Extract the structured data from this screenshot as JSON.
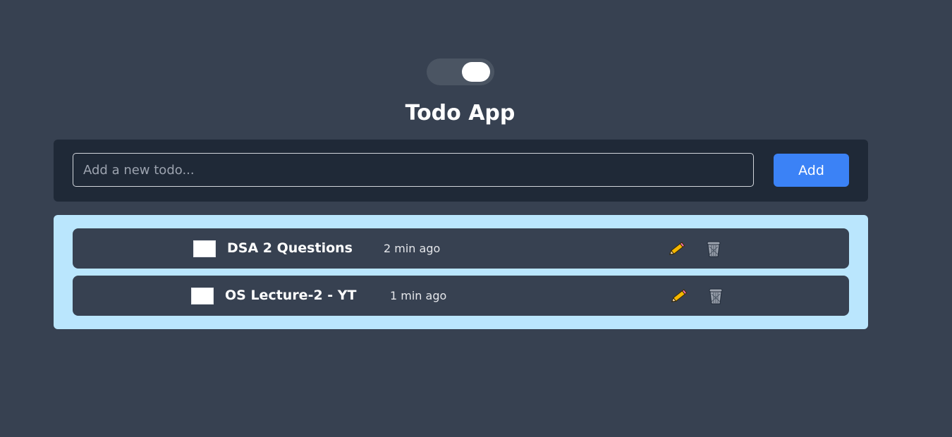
{
  "header": {
    "title": "Todo App"
  },
  "theme_toggle": {
    "state": "on"
  },
  "input": {
    "placeholder": "Add a new todo...",
    "value": ""
  },
  "add_button": {
    "label": "Add"
  },
  "todos": [
    {
      "text": "DSA 2 Questions",
      "time": "2 min ago",
      "checked": false
    },
    {
      "text": "OS Lecture-2 - YT",
      "time": "1 min ago",
      "checked": false
    }
  ],
  "icons": {
    "edit": "pencil-icon",
    "delete": "trash-icon"
  },
  "colors": {
    "background": "#374151",
    "panel": "#1f2937",
    "list_panel": "#bae6fd",
    "accent": "#3b82f6"
  }
}
